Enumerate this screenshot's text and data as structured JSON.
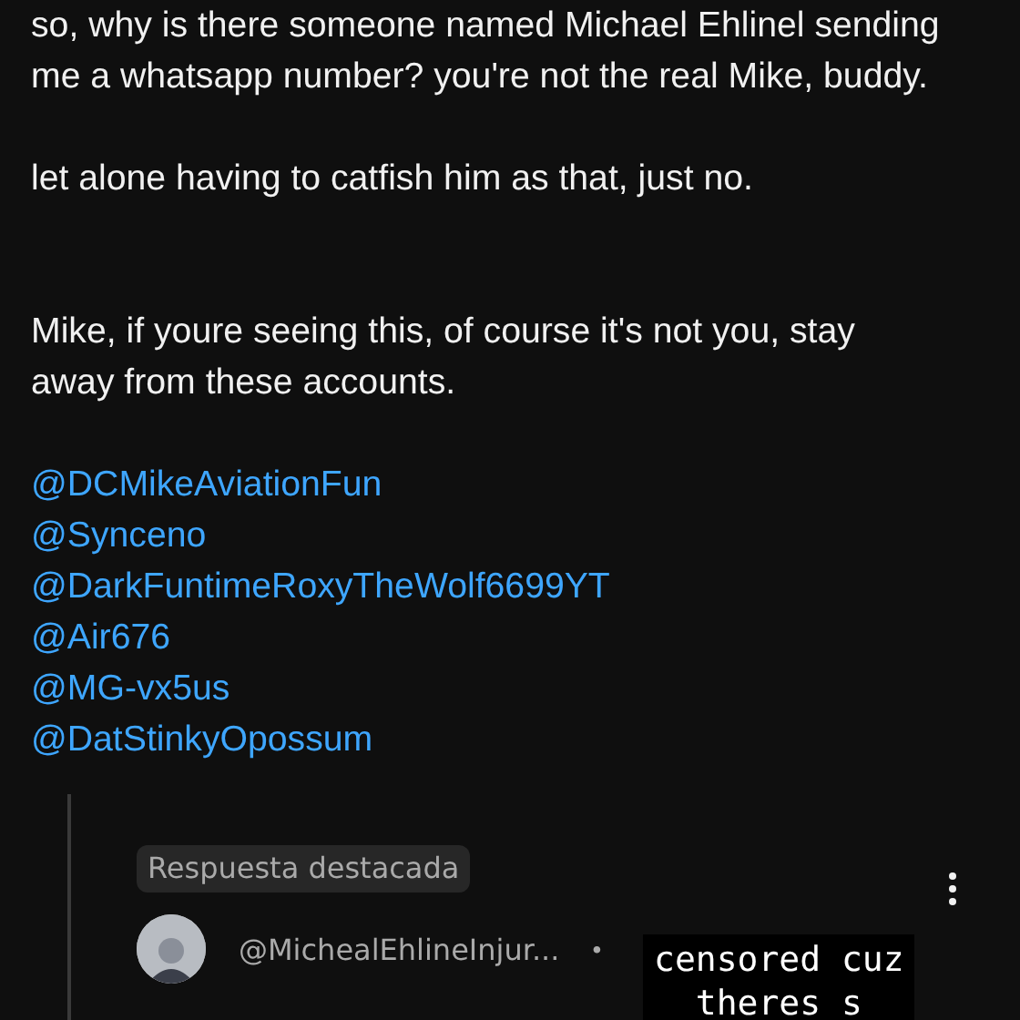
{
  "comment": {
    "paragraphs": [
      "so, why is there someone named Michael Ehlinel sending me a whatsapp number? you're not the real Mike, buddy.",
      "let alone having to catfish him as that, just no.",
      "Mike, if youre seeing this, of course it's not you, stay away from these accounts."
    ],
    "mentions": [
      "@DCMikeAviationFun",
      "@Synceno",
      "@DarkFuntimeRoxyTheWolf6699YT",
      "@Air676",
      "@MG-vx5us",
      "@DatStinkyOpossum"
    ]
  },
  "reply": {
    "badge": "Respuesta destacada",
    "author": "@MichealEhlineInjur...",
    "separator": "•"
  },
  "caption": [
    "censored cuz",
    "theres s"
  ]
}
